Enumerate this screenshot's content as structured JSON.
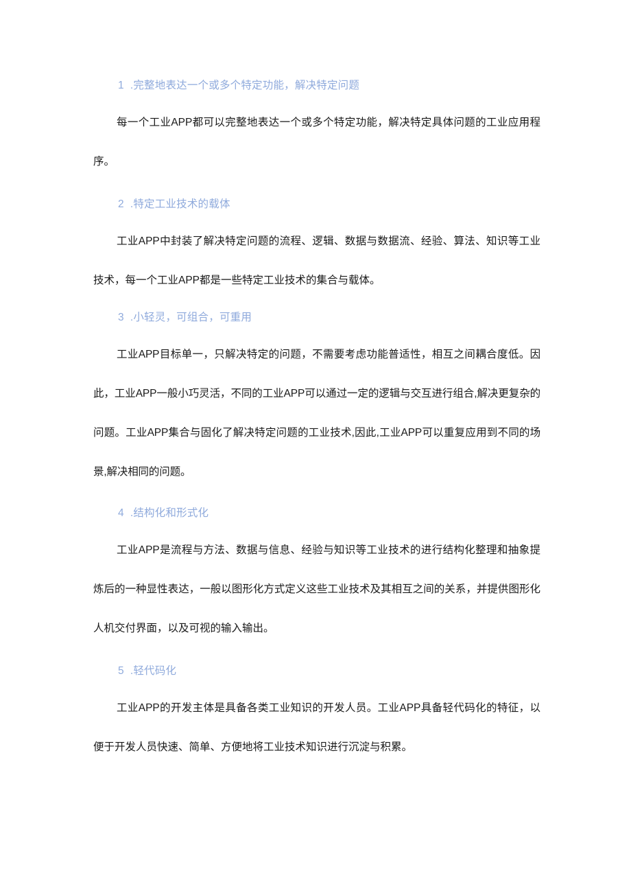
{
  "document": {
    "background_color": "#ffffff",
    "heading_color": "#8faadc",
    "body_color": "#1a1a1a"
  },
  "sections": [
    {
      "number": "1",
      "separator": ".",
      "heading": "完整地表达一个或多个特定功能，解决特定问题",
      "paragraph": "每一个工业APP都可以完整地表达一个或多个特定功能，解决特定具体问题的工业应用程序。"
    },
    {
      "number": "2",
      "separator": ".",
      "heading": "特定工业技术的载体",
      "paragraph": "工业APP中封装了解决特定问题的流程、逻辑、数据与数据流、经验、算法、知识等工业技术，每一个工业APP都是一些特定工业技术的集合与载体。"
    },
    {
      "number": "3",
      "separator": ".",
      "heading": "小轻灵，可组合，可重用",
      "paragraph": "工业APP目标单一，只解决特定的问题，不需要考虑功能普适性，相互之间耦合度低。因此，工业APP一般小巧灵活，不同的工业APP可以通过一定的逻辑与交互进行组合,解决更复杂的问题。工业APP集合与固化了解决特定问题的工业技术,因此,工业APP可以重复应用到不同的场景,解决相同的问题。"
    },
    {
      "number": "4",
      "separator": ".",
      "heading": "结构化和形式化",
      "paragraph": "工业APP是流程与方法、数据与信息、经验与知识等工业技术的进行结构化整理和抽象提炼后的一种显性表达，一般以图形化方式定义这些工业技术及其相互之间的关系，并提供图形化人机交付界面，以及可视的输入输出。"
    },
    {
      "number": "5",
      "separator": ".",
      "heading": "轻代码化",
      "paragraph": "工业APP的开发主体是具备各类工业知识的开发人员。工业APP具备轻代码化的特征，以便于开发人员快速、简单、方便地将工业技术知识进行沉淀与积累。"
    }
  ]
}
